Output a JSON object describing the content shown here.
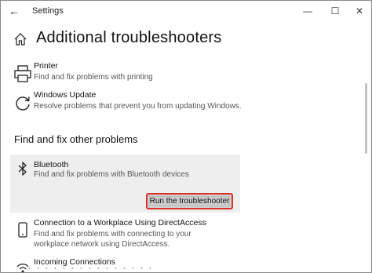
{
  "window": {
    "title": "Settings",
    "back_glyph": "←",
    "minimize_glyph": "—",
    "maximize_glyph": "☐",
    "close_glyph": "✕"
  },
  "page": {
    "title": "Additional troubleshooters",
    "home_icon": "home-icon"
  },
  "items": [
    {
      "name": "Printer",
      "description": "Find and fix problems with printing",
      "icon": "printer-icon"
    },
    {
      "name": "Windows Update",
      "description": "Resolve problems that prevent you from updating Windows.",
      "icon": "update-icon"
    }
  ],
  "section": {
    "title": "Find and fix other problems"
  },
  "bluetooth": {
    "name": "Bluetooth",
    "description": "Find and fix problems with Bluetooth devices",
    "icon": "bluetooth-icon",
    "button_label": "Run the troubleshooter",
    "highlight_color": "#d9342b"
  },
  "more_items": [
    {
      "name": "Connection to a Workplace Using DirectAccess",
      "description": "Find and fix problems with connecting to your workplace network using DirectAccess.",
      "icon": "phone-icon"
    },
    {
      "name": "Incoming Connections",
      "description": "",
      "icon": "incoming-connections-icon"
    }
  ],
  "colors": {
    "card_bg": "#eeeeee",
    "button_bg": "#cccccc"
  }
}
